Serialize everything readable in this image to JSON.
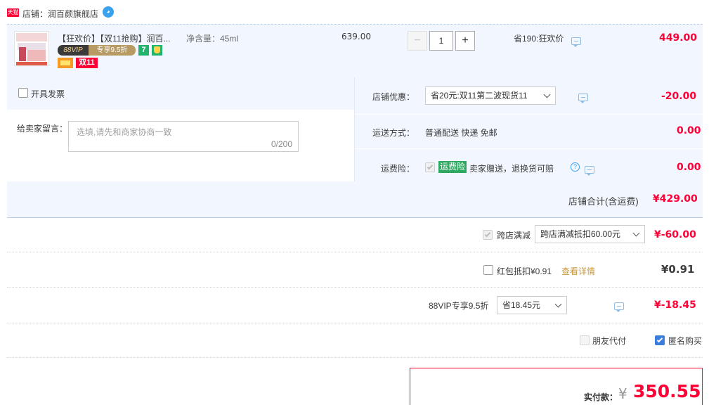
{
  "shop": {
    "tmall_badge": "天猫",
    "label": "店铺：",
    "name": "润百颜旗舰店"
  },
  "item": {
    "title": "【狂欢价】【双11抢购】润百...",
    "spec": "净含量：45ml",
    "vip_badge_left": "88VIP",
    "vip_badge_right": "专享9.5折",
    "badge_seven": "7",
    "double11_badge": "双11",
    "unit_price": "639.00",
    "quantity": "1",
    "minus": "−",
    "plus": "+",
    "promo_text": "省190:狂欢价",
    "subtotal": "449.00"
  },
  "invoice": {
    "label": "开具发票"
  },
  "message": {
    "label": "给卖家留言：",
    "placeholder": "选填,请先和商家协商一致",
    "counter": "0/200"
  },
  "store_discount": {
    "label": "店铺优惠：",
    "selected": "省20元:双11第二波现货11",
    "amount": "-20.00"
  },
  "delivery": {
    "label": "运送方式：",
    "value": "普通配送 快递 免邮",
    "amount": "0.00"
  },
  "insurance": {
    "label": "运费险：",
    "badge": "运费险",
    "desc": "卖家赠送，退换货可赔",
    "help": "?",
    "amount": "0.00"
  },
  "store_total": {
    "label": "店铺合计(含运费)",
    "amount": "¥429.00"
  },
  "cross_store": {
    "label": "跨店满减",
    "selected": "跨店满减抵扣60.00元",
    "amount": "¥-60.00"
  },
  "red_packet": {
    "label": "红包抵扣¥0.91",
    "link": "查看详情",
    "amount": "¥0.91"
  },
  "vip88": {
    "label": "88VIP专享9.5折",
    "selected": "省18.45元",
    "amount": "¥-18.45"
  },
  "options": {
    "friend_pay": "朋友代付",
    "anonymous": "匿名购买"
  },
  "payment": {
    "label": "实付款：",
    "currency": "¥",
    "amount": "350.55"
  },
  "colors": {
    "accent_red": "#ff0036",
    "panel_blue": "#f2f7ff",
    "tmall_red": "#ff0036",
    "checkbox_blue": "#3b7ddd",
    "insurance_green": "#2fa861"
  }
}
